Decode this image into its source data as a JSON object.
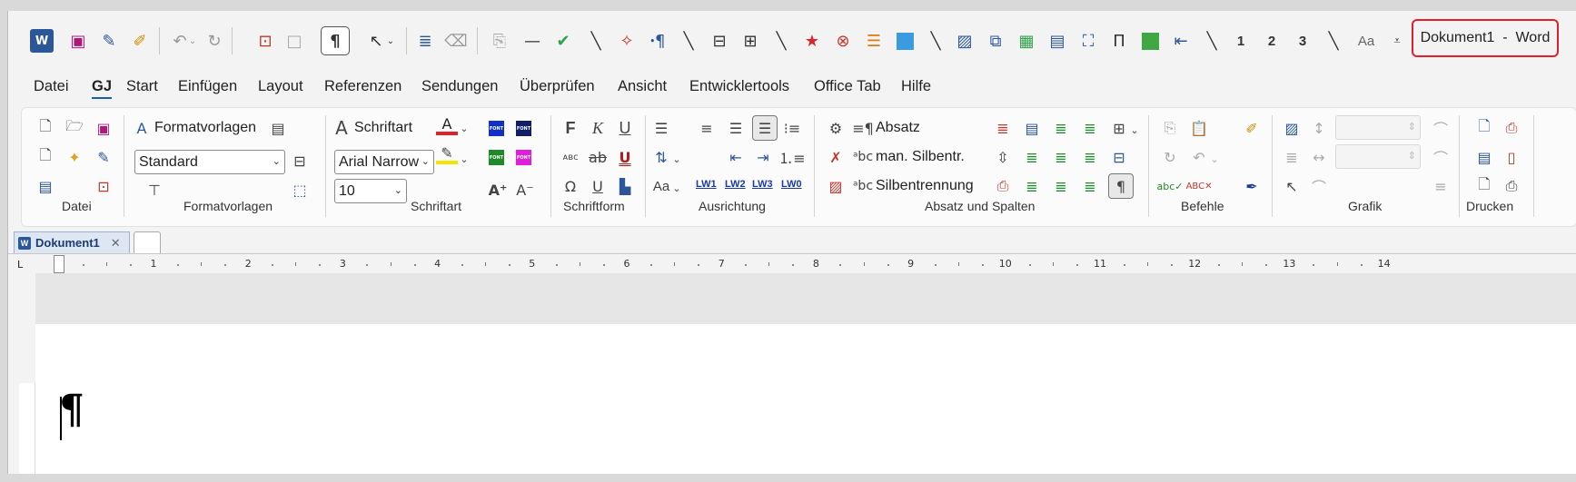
{
  "window": {
    "title": "Dokument1  -  Word"
  },
  "quick_access": {
    "number_buttons": [
      "1",
      "2",
      "3"
    ],
    "aa_label": "Aa"
  },
  "menu_tabs": [
    "Datei",
    "GJ",
    "Start",
    "Einfügen",
    "Layout",
    "Referenzen",
    "Sendungen",
    "Überprüfen",
    "Ansicht",
    "Entwicklertools",
    "Office Tab",
    "Hilfe"
  ],
  "active_tab": "GJ",
  "ribbon": {
    "groups": [
      "Datei",
      "Formatvorlagen",
      "Schriftart",
      "Schriftform",
      "Ausrichtung",
      "Absatz und Spalten",
      "Befehle",
      "Grafik",
      "Drucken"
    ],
    "formatvorlagen_label": "Formatvorlagen",
    "style_value": "Standard",
    "schriftart_label": "Schriftart",
    "font_value": "Arial Narrow",
    "size_value": "10",
    "schriftform": {
      "bold": "F",
      "italic": "K",
      "underline": "U"
    },
    "absatz_label": "Absatz",
    "silbentr_label": "man. Silbentr.",
    "silbentrennung_label": "Silbentrennung",
    "lw_buttons": [
      "LW1",
      "LW2",
      "LW3",
      "LW0"
    ],
    "font_colors": {
      "font_red": "#e0202a",
      "font_yellow": "#f5e400"
    },
    "font_icon_text": "FONT"
  },
  "document_tabs": [
    {
      "label": "Dokument1",
      "close": "✕"
    }
  ],
  "ruler": {
    "numbers": [
      "1",
      "2",
      "3",
      "4",
      "5",
      "6",
      "7",
      "8",
      "9",
      "10",
      "11",
      "12",
      "13",
      "14"
    ]
  },
  "document": {
    "pilcrow": "¶"
  }
}
